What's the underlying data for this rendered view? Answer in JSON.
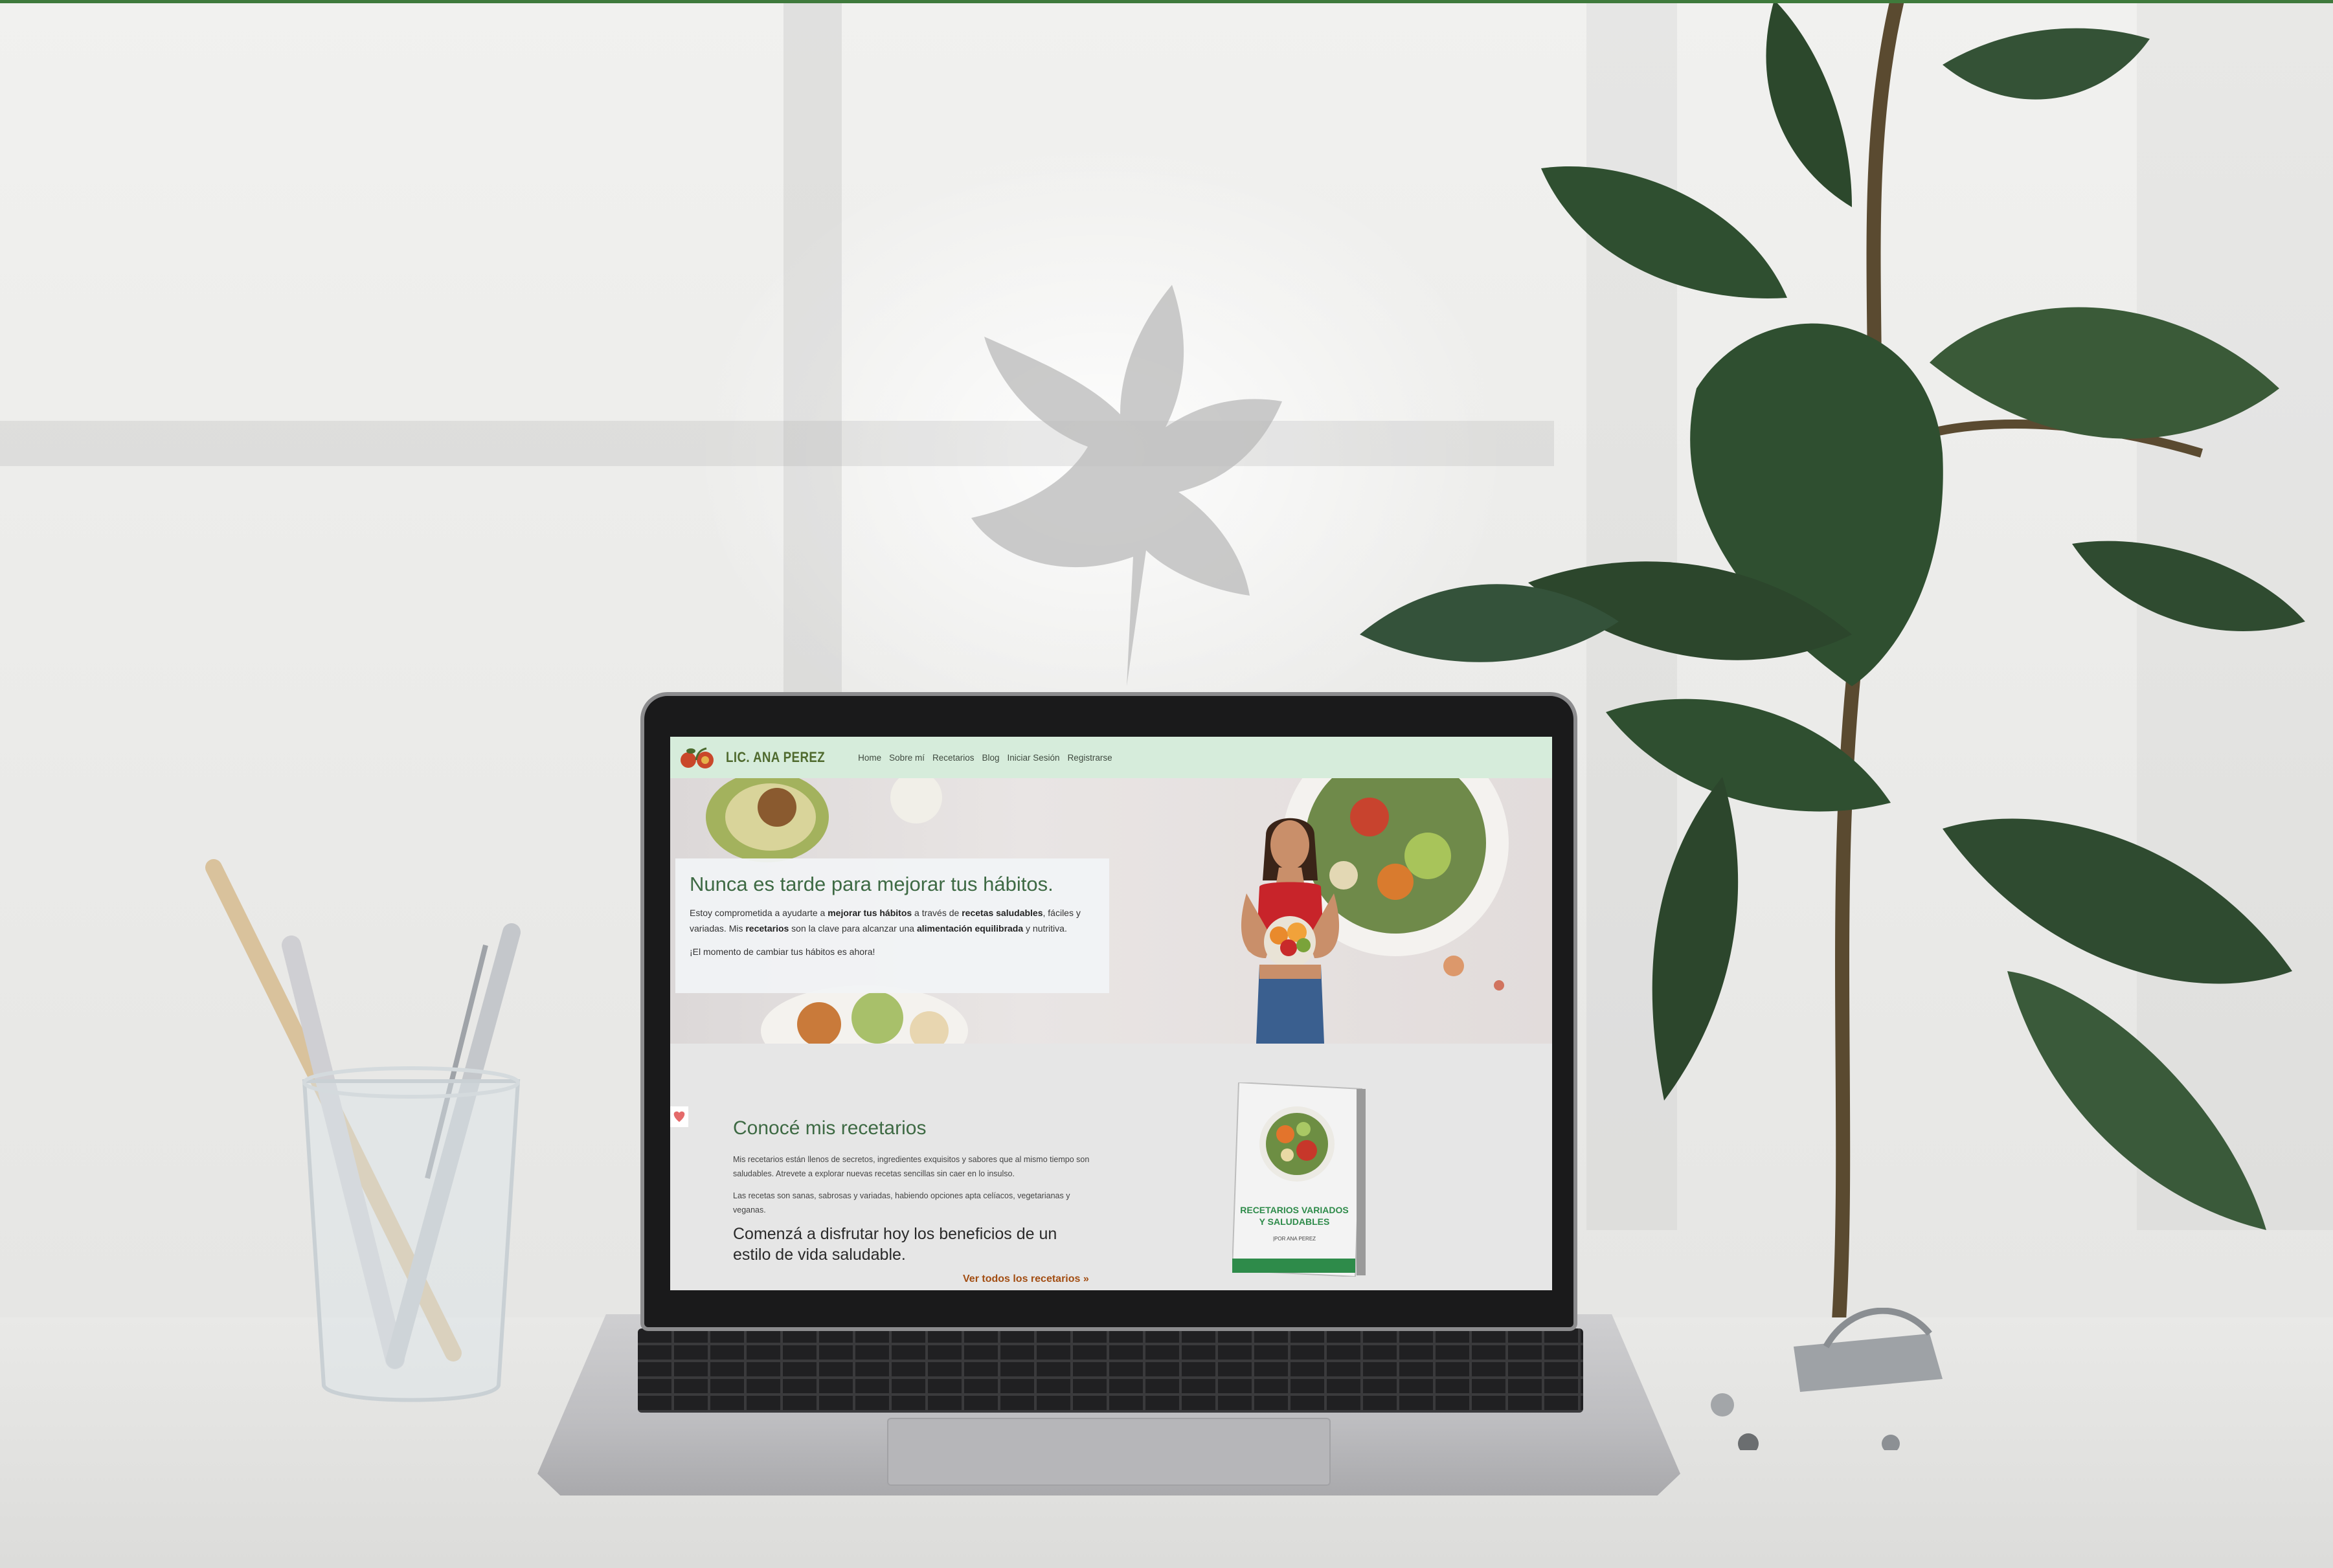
{
  "site": {
    "logo_text": "LIC. ANA PEREZ",
    "nav": [
      "Home",
      "Sobre mí",
      "Recetarios",
      "Blog",
      "Iniciar Sesión",
      "Registrarse"
    ]
  },
  "hero": {
    "title": "Nunca es tarde para mejorar tus hábitos.",
    "p1": {
      "t1": "Estoy comprometida a ayudarte a ",
      "b1": "mejorar tus hábitos",
      "t2": " a través de ",
      "b2": "recetas saludables",
      "t3": ", fáciles y variadas. Mis ",
      "b3": "recetarios",
      "t4": " son la clave para alcanzar una ",
      "b4": "alimentación equilibrada",
      "t5": " y nutritiva."
    },
    "cta_text": "¡El momento de cambiar tus hábitos es ahora!"
  },
  "recetarios": {
    "title": "Conocé mis recetarios",
    "p1": "Mis recetarios están llenos de secretos, ingredientes exquisitos y sabores que al mismo tiempo son saludables. Atrevete a explorar nuevas recetas sencillas sin caer en lo insulso.",
    "p2": "Las recetas son sanas, sabrosas y variadas, habiendo opciones apta celíacos, vegetarianas y veganas.",
    "subtitle": "Comenzá a disfrutar hoy los beneficios de un estilo de vida saludable.",
    "link": "Ver todos los recetarios »",
    "book_title_line1": "RECETARIOS VARIADOS",
    "book_title_line2": "Y SALUDABLES",
    "book_author": "|POR ANA PEREZ"
  },
  "colors": {
    "navbar": "#d6ecdb",
    "logo": "#4f6a2e",
    "heading_green": "#3e6a44",
    "link_brown": "#a24d12",
    "book_green": "#2e8b4a"
  }
}
